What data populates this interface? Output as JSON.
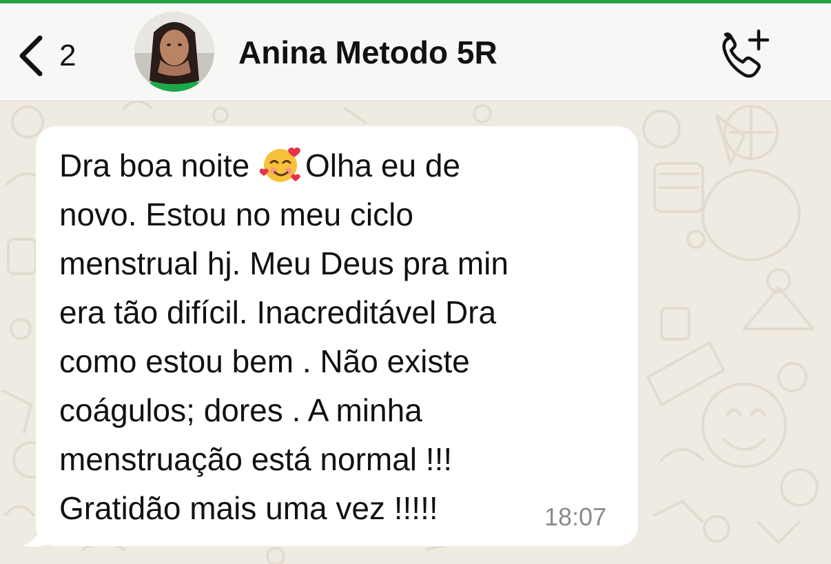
{
  "header": {
    "back_count": "2",
    "contact_name": "Anina Metodo 5R",
    "call_icon": "phone-plus-icon",
    "back_icon": "chevron-left-icon"
  },
  "message": {
    "lines": [
      "Dra boa noite ",
      "Olha eu de",
      "novo. Estou no meu ciclo",
      "menstrual hj. Meu Deus pra min",
      "era tão difícil. Inacreditável Dra",
      "como estou bem . Não existe",
      "coágulos; dores . A minha",
      "menstruação está normal !!!",
      "Gratidão mais uma vez !!!!!"
    ],
    "emoji": "smiling-face-with-hearts",
    "time": "18:07"
  },
  "colors": {
    "accent": "#25a244",
    "wallpaper": "#efeae2",
    "bubble": "#ffffff"
  }
}
